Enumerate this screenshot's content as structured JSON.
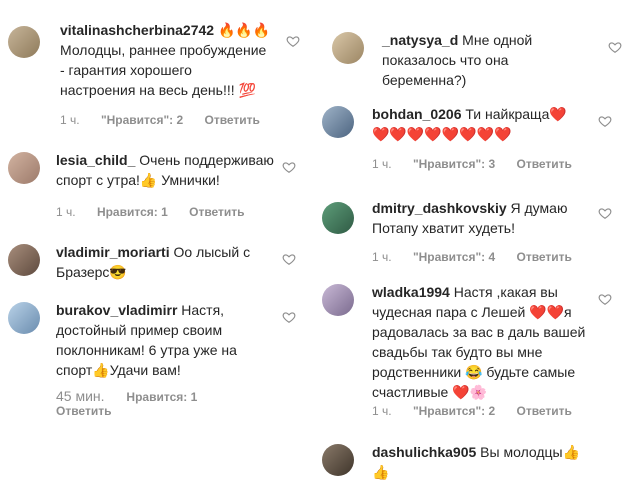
{
  "left_comments": [
    {
      "username": "vitalinashcherbina2742",
      "text": "🔥🔥🔥",
      "text2": "Молодцы, раннее пробуждение",
      "text3": "- гарантия хорошего",
      "text4": "настроения на весь день!!! 💯",
      "time": "1 ч.",
      "likes": "\"Нравится\": 2",
      "reply": "Ответить"
    },
    {
      "username": "lesia_child_",
      "text": "Очень поддерживаю",
      "text2": "спорт с утра!👍 Умнички!",
      "time": "1 ч.",
      "likes": "Нравится: 1",
      "reply": "Ответить"
    },
    {
      "username": "vladimir_moriarti",
      "text": "Оо лысый с",
      "text2": "Бразерс😎"
    },
    {
      "username": "burakov_vladimirr",
      "text": "Настя,",
      "text2": "достойный пример своим",
      "text3": "поклонникам! 6 утра уже на",
      "text4": "спорт👍Удачи вам!",
      "time": "45 мин.",
      "likes": "Нравится: 1",
      "reply": "Ответить"
    }
  ],
  "right_comments": [
    {
      "username": "_natysya_d",
      "text": "Мне одной",
      "text2": "показалось что она",
      "text3": "беременна?)"
    },
    {
      "username": "bohdan_0206",
      "text": "Ти найкраща❤️",
      "text2": "❤️❤️❤️❤️❤️❤️❤️❤️",
      "time": "1 ч.",
      "likes": "\"Нравится\": 3",
      "reply": "Ответить"
    },
    {
      "username": "dmitry_dashkovskiy",
      "text": "Я думаю",
      "text2": "Потапу хватит худеть!",
      "time": "1 ч.",
      "likes": "\"Нравится\": 4",
      "reply": "Ответить"
    },
    {
      "username": "wladka1994",
      "text": "Настя ,какая вы",
      "text2": "чудесная пара с Лешей ❤️❤️я",
      "text3": "радовалась за вас в даль вашей",
      "text4": "свадьбы так будто вы мне",
      "text5": "родственники 😂 будьте самые",
      "text6": "счастливые ❤️🌸",
      "time": "1 ч.",
      "likes": "\"Нравится\": 2",
      "reply": "Ответить"
    },
    {
      "username": "dashulichka905",
      "text": "Вы молодцы👍",
      "text2": "👍"
    }
  ]
}
